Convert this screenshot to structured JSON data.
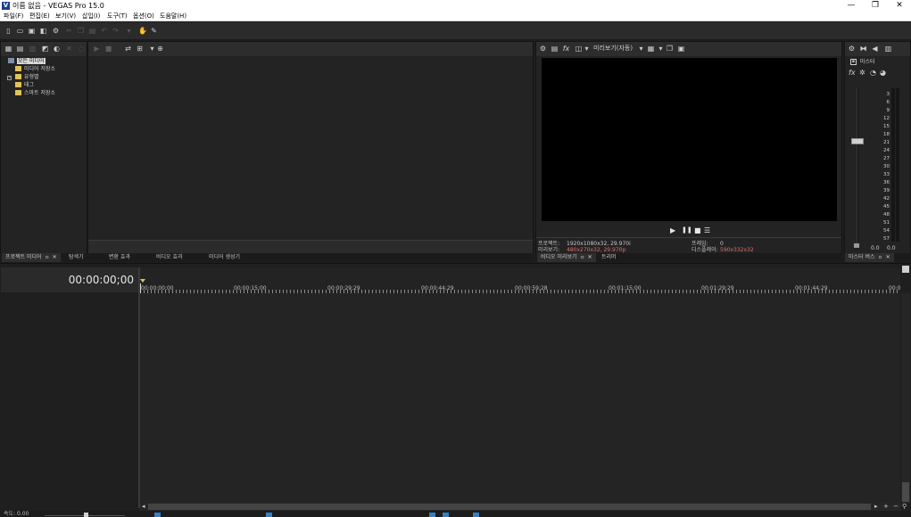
{
  "window": {
    "app_icon": "V",
    "title": "이름 없음 - VEGAS Pro 15.0",
    "minimize": "—",
    "restore": "❐",
    "close": "✕"
  },
  "menu": [
    "파일(F)",
    "편집(E)",
    "보기(V)",
    "삽입(I)",
    "도구(T)",
    "옵션(O)",
    "도움말(H)"
  ],
  "media_tree": {
    "items": [
      {
        "label": "모든 미디어",
        "selected": true
      },
      {
        "label": "미디어 저장소"
      },
      {
        "label": "유형별"
      },
      {
        "label": "태그"
      },
      {
        "label": "스마트 저장소"
      }
    ],
    "expander": "+"
  },
  "left_tabs": {
    "project_media": "프로젝트 미디어",
    "explorer": "탐색기",
    "transitions": "변환 효과",
    "video_fx": "비디오 효과",
    "media_generators": "미디어 생성기"
  },
  "preview": {
    "toolbar_label": "미리보기(자동)",
    "fx_label": "fx",
    "play": "▶",
    "pause": "❚❚",
    "stop": "■",
    "menu": "☰",
    "project_label": "프로젝트:",
    "project_value": "1920x1080x32, 29.970i",
    "preview_label": "미리보기:",
    "preview_value": "480x270x32, 29.970p",
    "frame_label": "프레임:",
    "frame_value": "0",
    "display_label": "디스플레이:",
    "display_value": "590x332x32",
    "tab_video_preview": "비디오 미리보기",
    "tab_trimmer": "트리머"
  },
  "master": {
    "label": "마스터",
    "fx_label": "fx",
    "meter_scale": [
      "3",
      "6",
      "9",
      "12",
      "15",
      "18",
      "21",
      "24",
      "27",
      "30",
      "33",
      "36",
      "39",
      "42",
      "45",
      "48",
      "51",
      "54",
      "57"
    ],
    "left_value": "0.0",
    "right_value": "0.0",
    "tab_master_bus": "마스터 버스"
  },
  "timeline": {
    "timecode": "00:00:00;00",
    "ruler": [
      "00:00:00;00",
      "00:00:15;00",
      "00:00:29;29",
      "00:00:44;29",
      "00:00:59;28",
      "00:01:15;00",
      "00:01:29;29",
      "00:01:44;29",
      "00:0"
    ],
    "rate_label": "속도: 0.00"
  }
}
